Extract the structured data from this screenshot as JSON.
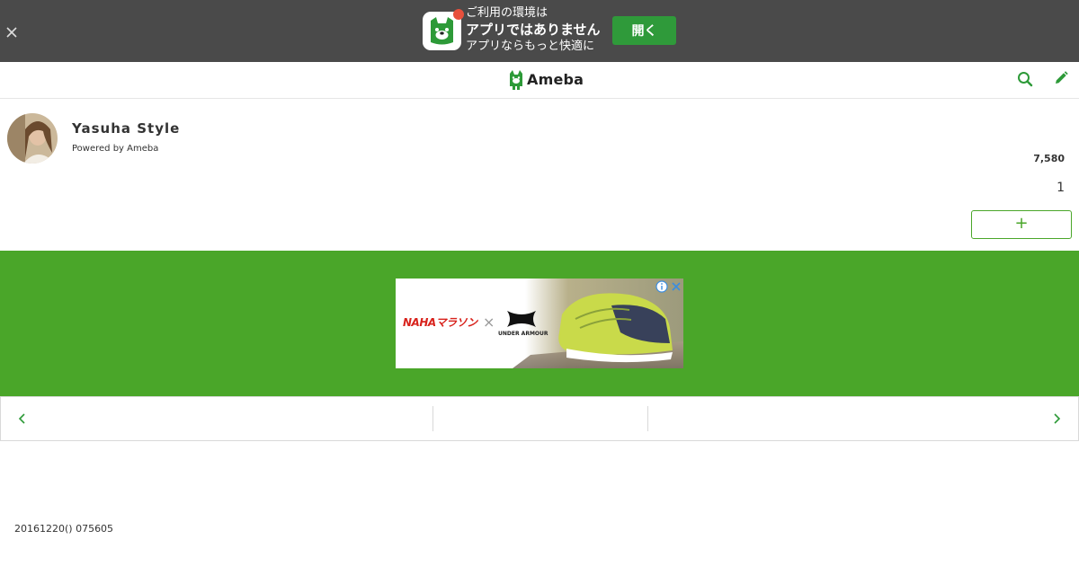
{
  "app_banner": {
    "line1": "ご利用の環境は",
    "line2": "アプリではありません",
    "line3": "アプリならもっと快適に",
    "open_label": "開く",
    "colors": {
      "background": "#4a4a4a",
      "button": "#2f9a3a",
      "dot": "#e8503c"
    }
  },
  "header": {
    "logo_text": "Ameba",
    "icons": [
      "close-icon",
      "search-icon",
      "pencil-icon"
    ]
  },
  "blog": {
    "title": "Yasuha Style",
    "title_prefix": "",
    "powered_by": "Powered by Ameba",
    "reader_count": "7,580",
    "ranking": "1",
    "follow_label": "+"
  },
  "ad": {
    "brand1": "NAHAマラソン",
    "separator": "×",
    "brand2": "UNDER ARMOUR"
  },
  "pager": {
    "prev_icon": "chevron-left-icon",
    "next_icon": "chevron-right-icon"
  },
  "entry": {
    "date": "20161220() 075605"
  },
  "colors": {
    "accent": "#4aa629",
    "ad_area": "#4aa629"
  }
}
